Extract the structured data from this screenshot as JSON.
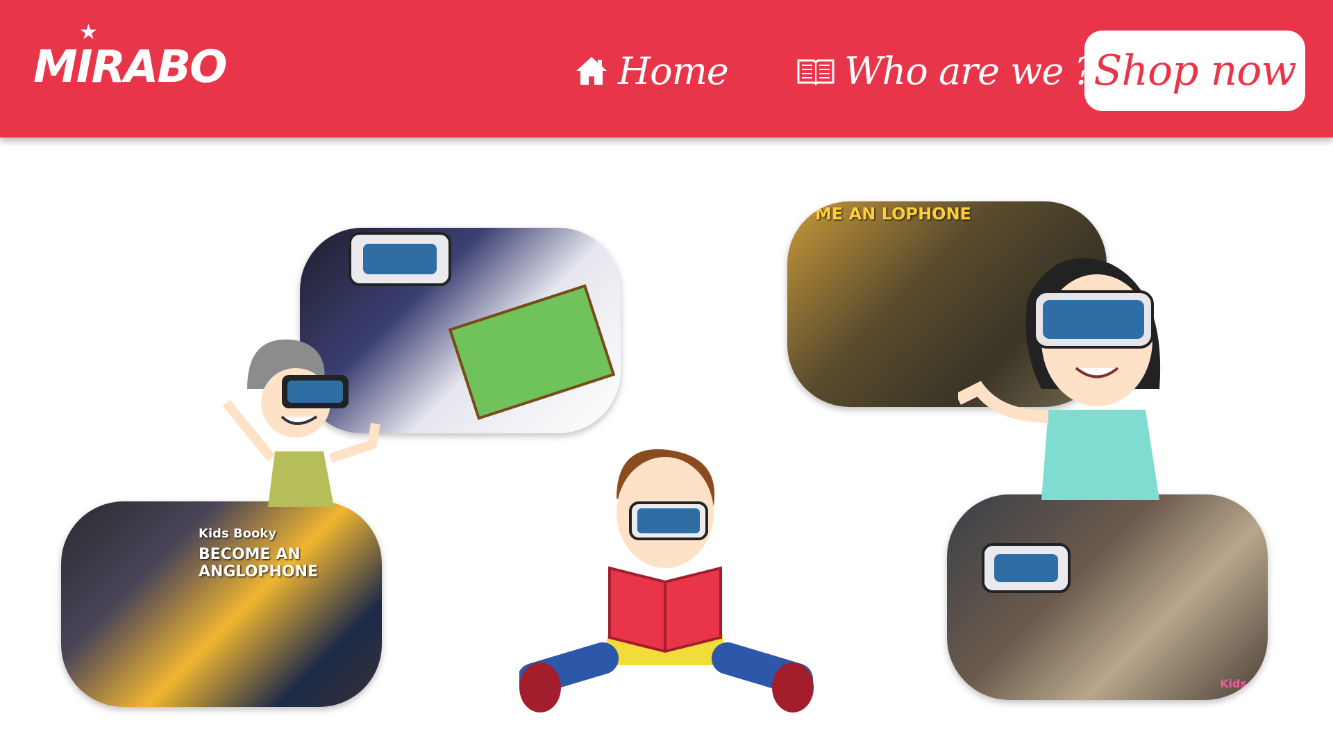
{
  "brand": {
    "logo_text": "MIRABO"
  },
  "nav": {
    "home": {
      "label": "Home",
      "icon": "home-icon"
    },
    "who": {
      "label": "Who are we ?",
      "icon": "book-icon"
    },
    "shop": {
      "label": "Shop now"
    }
  },
  "photos": {
    "bottom_left": {
      "poster_line1": "Kids Booky",
      "poster_line2": "BECOME AN ANGLOPHONE"
    },
    "top_right": {
      "poster_text": "ME AN LOPHONE"
    },
    "bottom_right": {
      "watermark": "Kids"
    }
  },
  "colors": {
    "primary": "#e8354a",
    "white": "#ffffff"
  }
}
